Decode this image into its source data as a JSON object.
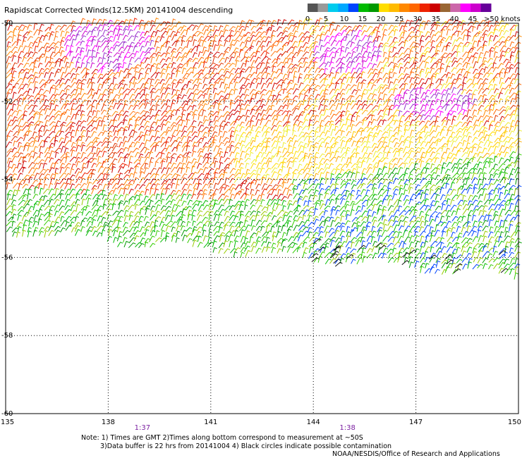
{
  "title": "Rapidscat Corrected Winds(12.5KM) 20141004 descending",
  "colorbar": {
    "labels": [
      "0",
      "5",
      "10",
      "15",
      "20",
      "25",
      "30",
      "35",
      "40",
      "45",
      ">50 knots"
    ],
    "colors": [
      "#555555",
      "#999999",
      "#00ccee",
      "#00a8ff",
      "#0044ff",
      "#00bb00",
      "#009900",
      "#ffdd00",
      "#ffbb00",
      "#ff8800",
      "#ff6600",
      "#ee2200",
      "#cc0000",
      "#996633",
      "#cc66aa",
      "#ff00ff",
      "#cc00cc",
      "#660099"
    ]
  },
  "map": {
    "lon_ticks": [
      "135",
      "138",
      "141",
      "144",
      "147",
      "150"
    ],
    "lat_ticks": [
      "-50",
      "-52",
      "-54",
      "-56",
      "-58",
      "-60"
    ],
    "lon_range": [
      135,
      150
    ],
    "lat_range": [
      -60,
      -50
    ],
    "time_labels": [
      {
        "lon": 139,
        "text": "1:37"
      },
      {
        "lon": 145,
        "text": "1:38"
      }
    ]
  },
  "notes": {
    "line1": "Note: 1) Times are GMT 2)Times along bottom correspond to measurement at ~50S",
    "line2": "3)Data buffer is 22 hrs from 20141004 4) Black circles indicate possible contamination",
    "line3": "NOAA/NESDIS/Office of Research and Applications"
  }
}
